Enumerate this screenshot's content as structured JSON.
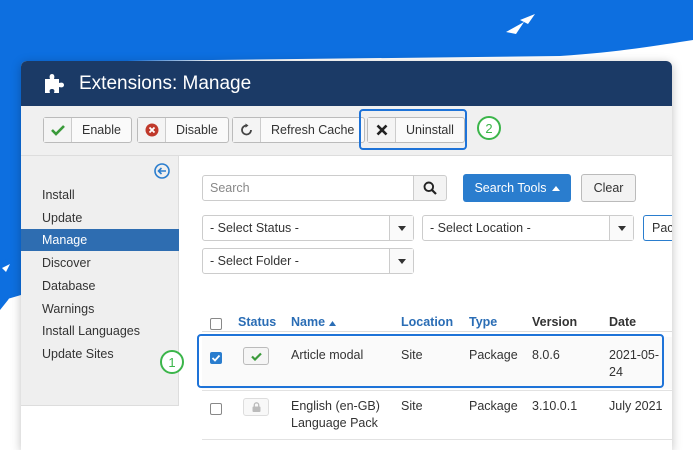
{
  "colors": {
    "splash": "#0d6fe0",
    "header": "#1b3a66",
    "accent": "#2a7dce",
    "highlight": "#1e73d8",
    "step_circle": "#3bb54a",
    "enable_check": "#3a9a3a",
    "disable_icon": "#c0392b"
  },
  "window": {
    "icon": "puzzle-icon",
    "title": "Extensions: Manage"
  },
  "toolbar": {
    "enable": {
      "label": "Enable",
      "icon": "check-icon"
    },
    "disable": {
      "label": "Disable",
      "icon": "x-circle-icon"
    },
    "refresh": {
      "label": "Refresh Cache",
      "icon": "refresh-icon"
    },
    "uninstall": {
      "label": "Uninstall",
      "icon": "x-icon"
    }
  },
  "annotations": {
    "step1": "1",
    "step2": "2"
  },
  "sidebar": {
    "collapse_icon": "arrow-left-circle-icon",
    "items": [
      {
        "label": "Install",
        "active": false
      },
      {
        "label": "Update",
        "active": false
      },
      {
        "label": "Manage",
        "active": true
      },
      {
        "label": "Discover",
        "active": false
      },
      {
        "label": "Database",
        "active": false
      },
      {
        "label": "Warnings",
        "active": false
      },
      {
        "label": "Install Languages",
        "active": false
      },
      {
        "label": "Update Sites",
        "active": false
      }
    ]
  },
  "search": {
    "placeholder": "Search",
    "tools_label": "Search Tools",
    "clear_label": "Clear"
  },
  "filters": {
    "status": "- Select Status -",
    "location": "- Select Location -",
    "type_partial": "Pac",
    "folder": "- Select Folder -"
  },
  "table": {
    "headers": {
      "status": "Status",
      "name": "Name",
      "location": "Location",
      "type": "Type",
      "version": "Version",
      "date": "Date"
    },
    "rows": [
      {
        "checked": true,
        "status": "enabled",
        "name": "Article modal",
        "location": "Site",
        "type": "Package",
        "version": "8.0.6",
        "date_line1": "2021-05-",
        "date_line2": "24"
      },
      {
        "checked": false,
        "status": "locked",
        "name_line1": "English (en-GB)",
        "name_line2": "Language Pack",
        "location": "Site",
        "type": "Package",
        "version": "3.10.0.1",
        "date": "July 2021"
      }
    ]
  }
}
